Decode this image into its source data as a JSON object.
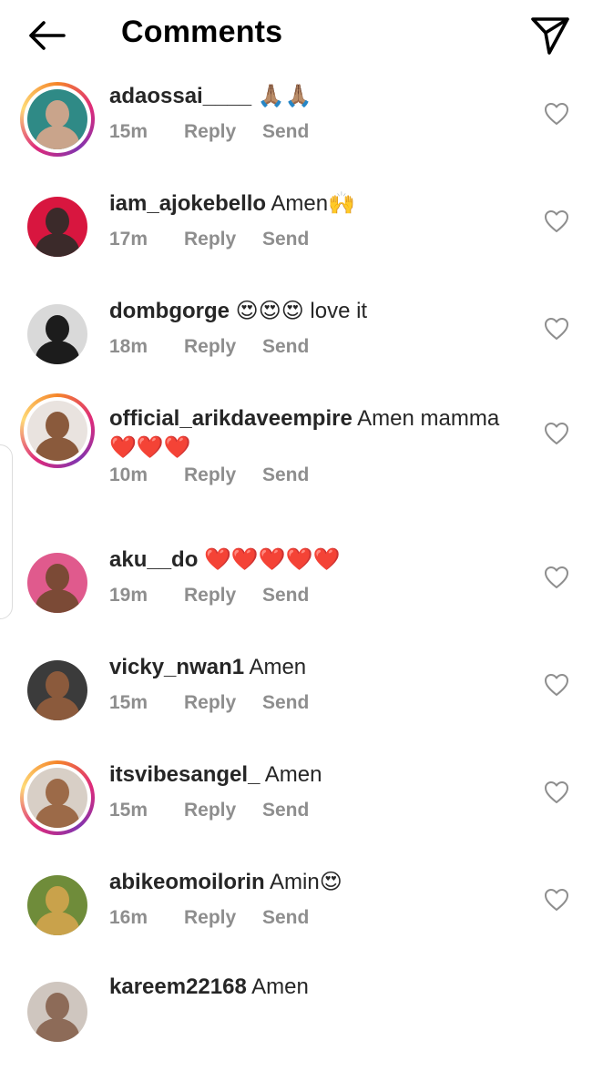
{
  "header": {
    "title": "Comments",
    "back_icon": "arrow-left-icon",
    "share_icon": "send-paper-plane-icon"
  },
  "comment_actions": {
    "reply": "Reply",
    "send": "Send"
  },
  "comments": [
    {
      "username": "adaossai____",
      "text": " 🙏🏽🙏🏽",
      "time": "15m",
      "story_ring": true,
      "avatar_colors": [
        "#2f8a86",
        "#c9a48b"
      ]
    },
    {
      "username": "iam_ajokebello",
      "text": " Amen🙌",
      "time": "17m",
      "story_ring": false,
      "avatar_colors": [
        "#d8163f",
        "#3b2a2a"
      ]
    },
    {
      "username": "dombgorge",
      "text": " 😍😍😍 love it",
      "time": "18m",
      "story_ring": false,
      "avatar_colors": [
        "#d9d9d9",
        "#1c1c1c"
      ]
    },
    {
      "username": "official_arikdaveempire",
      "text": " Amen mamma ❤️❤️❤️",
      "time": "10m",
      "story_ring": true,
      "avatar_colors": [
        "#e9e3df",
        "#8a5a3c"
      ]
    },
    {
      "username": "aku__do",
      "text": " ❤️❤️❤️❤️❤️",
      "time": "19m",
      "story_ring": false,
      "avatar_colors": [
        "#e05a8d",
        "#7b4a36"
      ]
    },
    {
      "username": "vicky_nwan1",
      "text": " Amen",
      "time": "15m",
      "story_ring": false,
      "avatar_colors": [
        "#3b3b3b",
        "#8b5a3c"
      ]
    },
    {
      "username": "itsvibesangel_",
      "text": " Amen",
      "time": "15m",
      "story_ring": true,
      "avatar_colors": [
        "#d8cfc6",
        "#9c6a48"
      ]
    },
    {
      "username": "abikeomoilorin",
      "text": " Amin😍",
      "time": "16m",
      "story_ring": false,
      "avatar_colors": [
        "#6f8c3a",
        "#c9a24b"
      ]
    },
    {
      "username": "kareem22168",
      "text": " Amen",
      "time": "",
      "story_ring": false,
      "avatar_colors": [
        "#cfc6bf",
        "#8d6b58"
      ]
    }
  ],
  "colors": {
    "meta_gray": "#8e8e8e",
    "text": "#262626",
    "story_ring": "#dd2a7b"
  }
}
